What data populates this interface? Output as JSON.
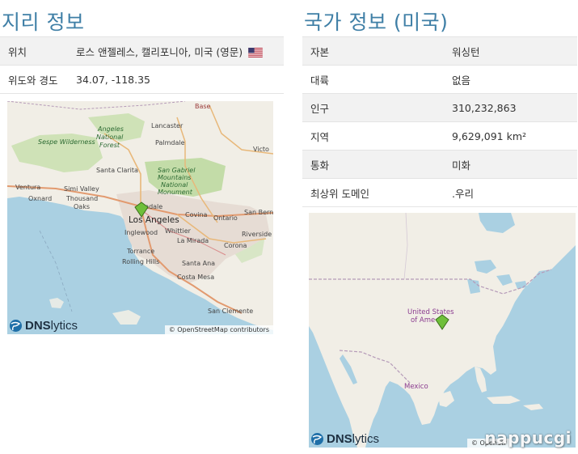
{
  "geo": {
    "title": "지리 정보",
    "rows": [
      {
        "key": "위치",
        "value": "로스 앤젤레스, 캘리포니아, 미국 (영문)"
      },
      {
        "key": "위도와 경도",
        "value": "34.07, -118.35"
      }
    ],
    "map": {
      "credit": "© OpenStreetMap contributors",
      "logo": {
        "dns": "DNS",
        "lytics": "lytics"
      },
      "labels": {
        "base": "Base",
        "lancaster": "Lancaster",
        "angeles_nf_1": "Angeles",
        "angeles_nf_2": "National",
        "angeles_nf_3": "Forest",
        "sespe": "Sespe Wilderness",
        "palmdale": "Palmdale",
        "victorville": "Victo",
        "santa_clarita": "Santa Clarita",
        "sgm_1": "San Gabriel",
        "sgm_2": "Mountains",
        "sgm_3": "National",
        "sgm_4": "Monument",
        "ventura": "Ventura",
        "simi_valley": "Simi Valley",
        "oxnard": "Oxnard",
        "thousand_oaks_1": "Thousand",
        "thousand_oaks_2": "Oaks",
        "glendale": "ndale",
        "los_angeles": "Los Angeles",
        "covina": "Covina",
        "ontario": "Ontario",
        "san_bernardino": "San Bern",
        "inglewood": "Inglewood",
        "whittier": "Whittier",
        "riverside": "Riverside",
        "la_mirada": "La Mirada",
        "corona": "Corona",
        "torrance": "Torrance",
        "rolling_hills": "Rolling Hills",
        "santa_ana": "Santa Ana",
        "costa_mesa": "Costa Mesa",
        "san_clemente": "San Clemente"
      }
    }
  },
  "country": {
    "title": "국가 정보 (미국)",
    "rows": [
      {
        "key": "자본",
        "value": "워싱턴"
      },
      {
        "key": "대륙",
        "value": "없음"
      },
      {
        "key": "인구",
        "value": "310,232,863"
      },
      {
        "key": "지역",
        "value": "9,629,091 km²"
      },
      {
        "key": "통화",
        "value": "미화"
      },
      {
        "key": "최상위 도메인",
        "value": ".우리"
      }
    ],
    "map": {
      "credit": "© OpenStr",
      "logo": {
        "dns": "DNS",
        "lytics": "lytics"
      },
      "labels": {
        "us_1": "United States",
        "us_2": "of Ame",
        "mexico": "Mexico"
      }
    }
  },
  "watermark": "nappucgi",
  "colors": {
    "title": "#3f7fa6",
    "water": "#a9cbe0",
    "land": "#f1eee6",
    "park": "#c6dfb0",
    "pin": "#6fbf3a"
  },
  "icons": {
    "flag": "us-flag-icon",
    "pin": "map-pin-icon",
    "logo": "dnslytics-globe-icon"
  }
}
